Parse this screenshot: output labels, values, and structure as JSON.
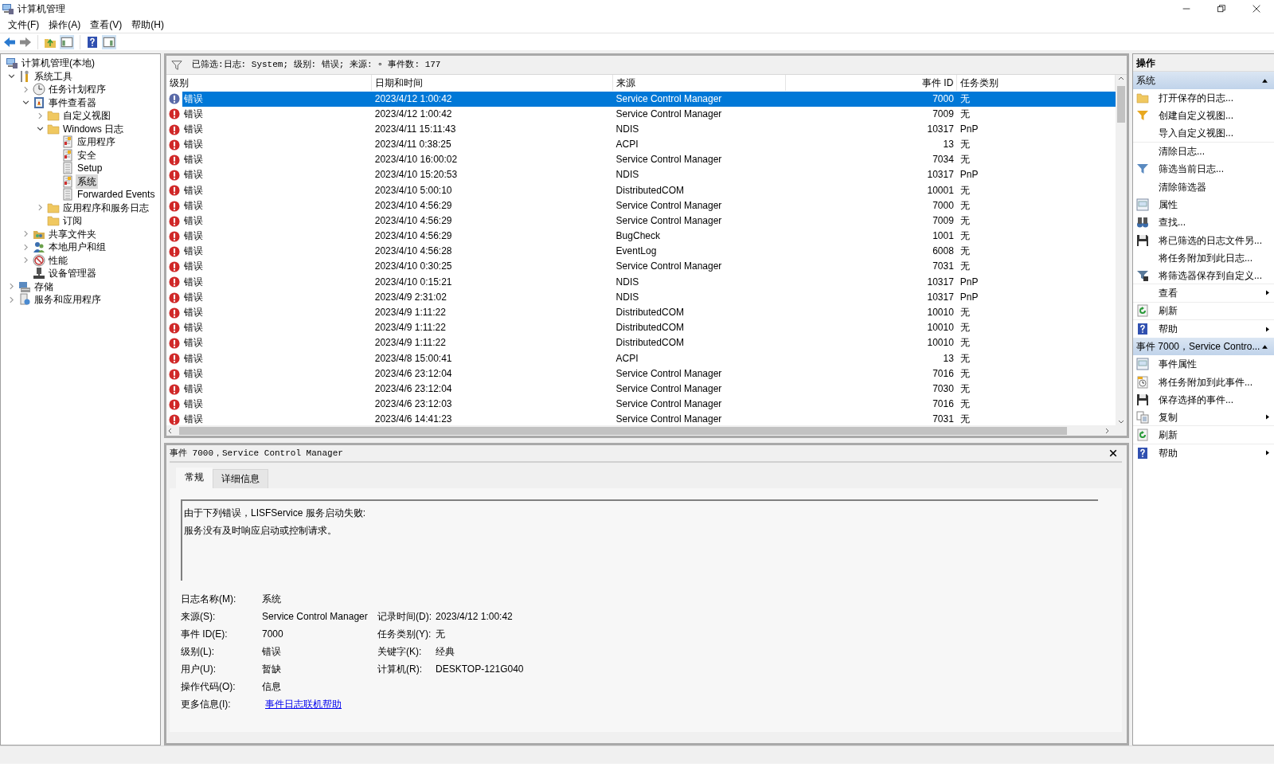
{
  "window": {
    "title": "计算机管理"
  },
  "menu": [
    {
      "label": "文件(F)"
    },
    {
      "label": "操作(A)"
    },
    {
      "label": "查看(V)"
    },
    {
      "label": "帮助(H)"
    }
  ],
  "tree": [
    {
      "label": "计算机管理(本地)",
      "kind": "computer",
      "selected": false,
      "children": [
        {
          "label": "系统工具",
          "kind": "tools",
          "expanded": true,
          "selected": false,
          "children": [
            {
              "label": "任务计划程序",
              "kind": "clock",
              "expanded": false,
              "selected": false
            },
            {
              "label": "事件查看器",
              "kind": "viewer",
              "expanded": true,
              "selected": false,
              "children": [
                {
                  "label": "自定义视图",
                  "kind": "folder",
                  "expanded": false,
                  "selected": false
                },
                {
                  "label": "Windows 日志",
                  "kind": "folder",
                  "expanded": true,
                  "selected": false,
                  "children": [
                    {
                      "label": "应用程序",
                      "kind": "log",
                      "selected": false
                    },
                    {
                      "label": "安全",
                      "kind": "log",
                      "selected": false
                    },
                    {
                      "label": "Setup",
                      "kind": "logplain",
                      "selected": false
                    },
                    {
                      "label": "系统",
                      "kind": "log",
                      "selected": true
                    },
                    {
                      "label": "Forwarded Events",
                      "kind": "logplain",
                      "selected": false
                    }
                  ]
                },
                {
                  "label": "应用程序和服务日志",
                  "kind": "folder",
                  "expanded": false,
                  "selected": false
                },
                {
                  "label": "订阅",
                  "kind": "folder",
                  "selected": false
                }
              ]
            },
            {
              "label": "共享文件夹",
              "kind": "share",
              "expanded": false,
              "selected": false
            },
            {
              "label": "本地用户和组",
              "kind": "users",
              "expanded": false,
              "selected": false
            },
            {
              "label": "性能",
              "kind": "perf",
              "expanded": false,
              "selected": false
            },
            {
              "label": "设备管理器",
              "kind": "device",
              "selected": false
            }
          ]
        },
        {
          "label": "存储",
          "kind": "storage",
          "expanded": false,
          "selected": false
        },
        {
          "label": "服务和应用程序",
          "kind": "services",
          "expanded": false,
          "selected": false
        }
      ]
    }
  ],
  "filter_bar": {
    "text": "已筛选:日志: System; 级别: 错误; 来源: ∘ 事件数: 177"
  },
  "table": {
    "columns": [
      "级别",
      "日期和时间",
      "来源",
      "事件 ID",
      "任务类别"
    ],
    "rows": [
      {
        "level": "错误",
        "datetime": "2023/4/12 1:00:42",
        "source": "Service Control Manager",
        "event_id": "7000",
        "task_category": "无",
        "selected": true
      },
      {
        "level": "错误",
        "datetime": "2023/4/12 1:00:42",
        "source": "Service Control Manager",
        "event_id": "7009",
        "task_category": "无",
        "selected": false
      },
      {
        "level": "错误",
        "datetime": "2023/4/11 15:11:43",
        "source": "NDIS",
        "event_id": "10317",
        "task_category": "PnP",
        "selected": false
      },
      {
        "level": "错误",
        "datetime": "2023/4/11 0:38:25",
        "source": "ACPI",
        "event_id": "13",
        "task_category": "无",
        "selected": false
      },
      {
        "level": "错误",
        "datetime": "2023/4/10 16:00:02",
        "source": "Service Control Manager",
        "event_id": "7034",
        "task_category": "无",
        "selected": false
      },
      {
        "level": "错误",
        "datetime": "2023/4/10 15:20:53",
        "source": "NDIS",
        "event_id": "10317",
        "task_category": "PnP",
        "selected": false
      },
      {
        "level": "错误",
        "datetime": "2023/4/10 5:00:10",
        "source": "DistributedCOM",
        "event_id": "10001",
        "task_category": "无",
        "selected": false
      },
      {
        "level": "错误",
        "datetime": "2023/4/10 4:56:29",
        "source": "Service Control Manager",
        "event_id": "7000",
        "task_category": "无",
        "selected": false
      },
      {
        "level": "错误",
        "datetime": "2023/4/10 4:56:29",
        "source": "Service Control Manager",
        "event_id": "7009",
        "task_category": "无",
        "selected": false
      },
      {
        "level": "错误",
        "datetime": "2023/4/10 4:56:29",
        "source": "BugCheck",
        "event_id": "1001",
        "task_category": "无",
        "selected": false
      },
      {
        "level": "错误",
        "datetime": "2023/4/10 4:56:28",
        "source": "EventLog",
        "event_id": "6008",
        "task_category": "无",
        "selected": false
      },
      {
        "level": "错误",
        "datetime": "2023/4/10 0:30:25",
        "source": "Service Control Manager",
        "event_id": "7031",
        "task_category": "无",
        "selected": false
      },
      {
        "level": "错误",
        "datetime": "2023/4/10 0:15:21",
        "source": "NDIS",
        "event_id": "10317",
        "task_category": "PnP",
        "selected": false
      },
      {
        "level": "错误",
        "datetime": "2023/4/9 2:31:02",
        "source": "NDIS",
        "event_id": "10317",
        "task_category": "PnP",
        "selected": false
      },
      {
        "level": "错误",
        "datetime": "2023/4/9 1:11:22",
        "source": "DistributedCOM",
        "event_id": "10010",
        "task_category": "无",
        "selected": false
      },
      {
        "level": "错误",
        "datetime": "2023/4/9 1:11:22",
        "source": "DistributedCOM",
        "event_id": "10010",
        "task_category": "无",
        "selected": false
      },
      {
        "level": "错误",
        "datetime": "2023/4/9 1:11:22",
        "source": "DistributedCOM",
        "event_id": "10010",
        "task_category": "无",
        "selected": false
      },
      {
        "level": "错误",
        "datetime": "2023/4/8 15:00:41",
        "source": "ACPI",
        "event_id": "13",
        "task_category": "无",
        "selected": false
      },
      {
        "level": "错误",
        "datetime": "2023/4/6 23:12:04",
        "source": "Service Control Manager",
        "event_id": "7016",
        "task_category": "无",
        "selected": false
      },
      {
        "level": "错误",
        "datetime": "2023/4/6 23:12:04",
        "source": "Service Control Manager",
        "event_id": "7030",
        "task_category": "无",
        "selected": false
      },
      {
        "level": "错误",
        "datetime": "2023/4/6 23:12:03",
        "source": "Service Control Manager",
        "event_id": "7016",
        "task_category": "无",
        "selected": false
      },
      {
        "level": "错误",
        "datetime": "2023/4/6 14:41:23",
        "source": "Service Control Manager",
        "event_id": "7031",
        "task_category": "无",
        "selected": false
      }
    ]
  },
  "details": {
    "title": "事件 7000，Service Control Manager",
    "tabs": [
      {
        "label": "常规",
        "selected": true
      },
      {
        "label": "详细信息",
        "selected": false
      }
    ],
    "description": [
      "由于下列错误，LISFService 服务启动失败:",
      "服务没有及时响应启动或控制请求。"
    ],
    "rows": [
      [
        {
          "label": "日志名称(M):",
          "value": "系统"
        }
      ],
      [
        {
          "label": "来源(S):",
          "value": "Service Control Manager"
        },
        {
          "label": "记录时间(D):",
          "value": "2023/4/12 1:00:42"
        }
      ],
      [
        {
          "label": "事件 ID(E):",
          "value": "7000"
        },
        {
          "label": "任务类别(Y):",
          "value": "无"
        }
      ],
      [
        {
          "label": "级别(L):",
          "value": "错误"
        },
        {
          "label": "关键字(K):",
          "value": "经典"
        }
      ],
      [
        {
          "label": "用户(U):",
          "value": "暂缺"
        },
        {
          "label": "计算机(R):",
          "value": "DESKTOP-121G040"
        }
      ],
      [
        {
          "label": "操作代码(O):",
          "value": "信息"
        }
      ],
      [
        {
          "label": "更多信息(I):",
          "value": "事件日志联机帮助",
          "kind": "link"
        }
      ]
    ]
  },
  "actions": {
    "title": "操作",
    "sections": [
      {
        "title": "系统",
        "expanded": true,
        "items": [
          {
            "label": "打开保存的日志...",
            "kind": "folder",
            "submenu": false
          },
          {
            "label": "创建自定义视图...",
            "kind": "funnel-yellow",
            "submenu": false
          },
          {
            "label": "导入自定义视图...",
            "submenu": false,
            "divider_after": true
          },
          {
            "label": "清除日志...",
            "submenu": false
          },
          {
            "label": "筛选当前日志...",
            "kind": "funnel-blue",
            "submenu": false
          },
          {
            "label": "清除筛选器",
            "submenu": false
          },
          {
            "label": "属性",
            "kind": "props",
            "submenu": false
          },
          {
            "label": "查找...",
            "kind": "binoculars",
            "submenu": false
          },
          {
            "label": "将已筛选的日志文件另...",
            "kind": "floppy",
            "submenu": false
          },
          {
            "label": "将任务附加到此日志...",
            "submenu": false
          },
          {
            "label": "将筛选器保存到自定义...",
            "kind": "filter-save",
            "submenu": false,
            "divider_after": true
          },
          {
            "label": "查看",
            "submenu": true,
            "divider_after": true
          },
          {
            "label": "刷新",
            "kind": "refresh",
            "submenu": false,
            "divider_after": true
          },
          {
            "label": "帮助",
            "kind": "help",
            "submenu": true
          }
        ]
      },
      {
        "title": "事件 7000，Service Contro...",
        "expanded": true,
        "items": [
          {
            "label": "事件属性",
            "kind": "props",
            "submenu": false
          },
          {
            "label": "将任务附加到此事件...",
            "kind": "task",
            "submenu": false
          },
          {
            "label": "保存选择的事件...",
            "kind": "floppy",
            "submenu": false
          },
          {
            "label": "复制",
            "kind": "copy",
            "submenu": true,
            "divider_after": true
          },
          {
            "label": "刷新",
            "kind": "refresh",
            "submenu": false,
            "divider_after": true
          },
          {
            "label": "帮助",
            "kind": "help",
            "submenu": true
          }
        ]
      }
    ]
  }
}
